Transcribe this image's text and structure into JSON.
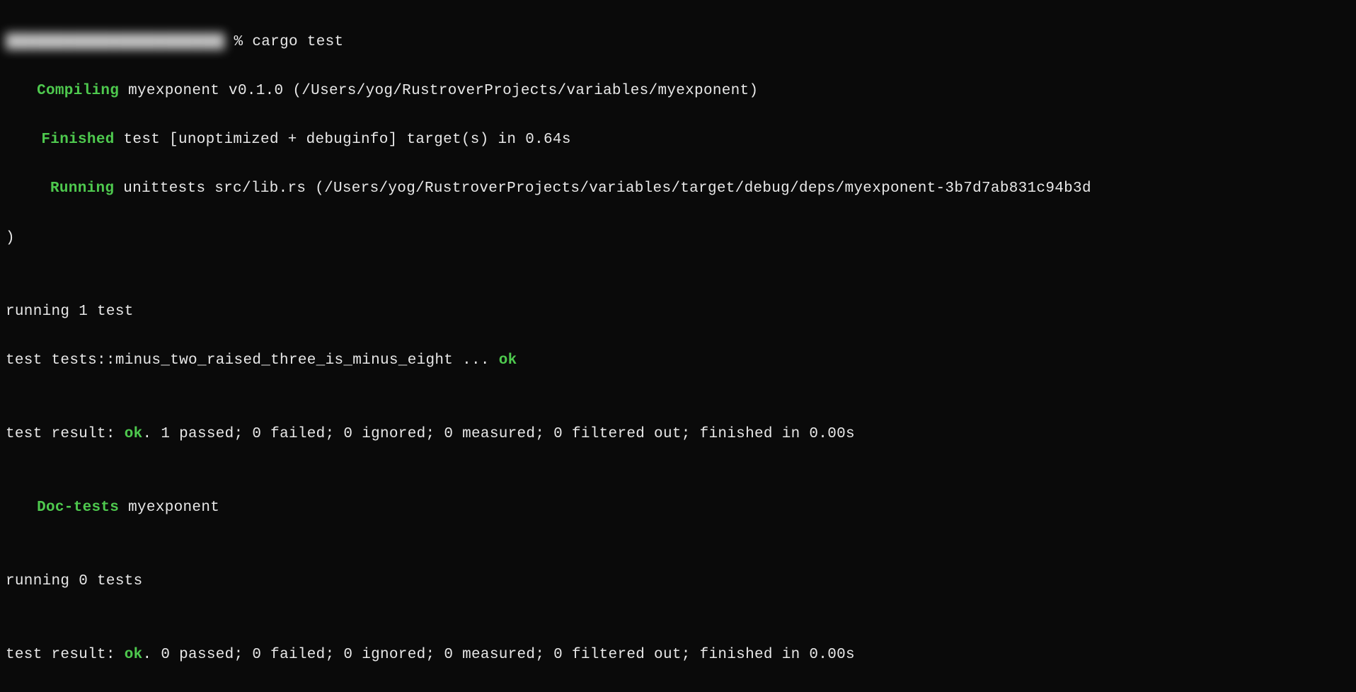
{
  "colors": {
    "background": "#0a0a0a",
    "text": "#e8e8e8",
    "accent_green": "#4ec94e"
  },
  "prompt": {
    "redacted_prefix": "████████████████████████",
    "symbol": " % ",
    "command": "cargo test"
  },
  "compile": {
    "label": "Compiling",
    "text": " myexponent v0.1.0 (/Users/yog/RustroverProjects/variables/myexponent)"
  },
  "finished": {
    "label": "Finished",
    "text": " test [unoptimized + debuginfo] target(s) in 0.64s"
  },
  "running": {
    "label": "Running",
    "text": " unittests src/lib.rs (/Users/yog/RustroverProjects/variables/target/debug/deps/myexponent-3b7d7ab831c94b3d"
  },
  "running_close": ")",
  "blank": "",
  "tests1": {
    "running_line": "running 1 test",
    "test_name": "test tests::minus_two_raised_three_is_minus_eight ... ",
    "test_status": "ok",
    "result_prefix": "test result: ",
    "result_status": "ok",
    "result_rest": ". 1 passed; 0 failed; 0 ignored; 0 measured; 0 filtered out; finished in 0.00s"
  },
  "doctests": {
    "label": "Doc-tests",
    "text": " myexponent"
  },
  "tests2": {
    "running_line": "running 0 tests",
    "result_prefix": "test result: ",
    "result_status": "ok",
    "result_rest": ". 0 passed; 0 failed; 0 ignored; 0 measured; 0 filtered out; finished in 0.00s"
  }
}
